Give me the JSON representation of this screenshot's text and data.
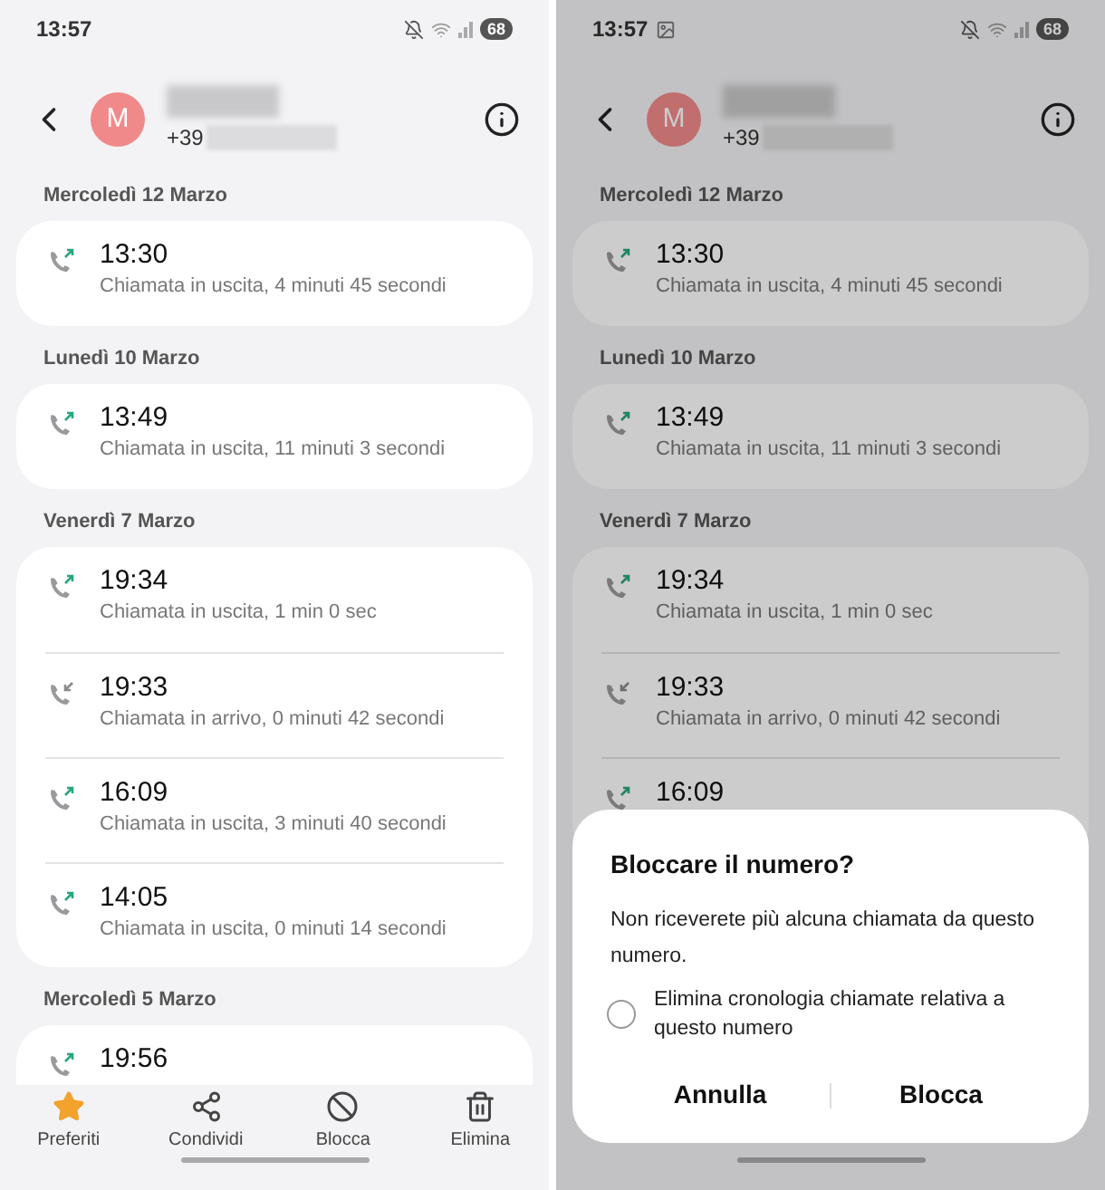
{
  "screens": [
    {
      "status_bar": {
        "time": "13:57",
        "photo_notification": false,
        "battery": "68"
      },
      "contact": {
        "initial": "M",
        "number_prefix": "+39"
      },
      "groups": [
        {
          "date": "Mercoledì 12 Marzo",
          "calls": [
            {
              "kind": "outgoing",
              "time": "13:30",
              "detail": "Chiamata in uscita, 4 minuti 45 secondi"
            }
          ]
        },
        {
          "date": "Lunedì 10 Marzo",
          "calls": [
            {
              "kind": "outgoing",
              "time": "13:49",
              "detail": "Chiamata in uscita, 11 minuti 3 secondi"
            }
          ]
        },
        {
          "date": "Venerdì 7 Marzo",
          "calls": [
            {
              "kind": "outgoing",
              "time": "19:34",
              "detail": "Chiamata in uscita, 1 min 0 sec"
            },
            {
              "kind": "incoming",
              "time": "19:33",
              "detail": "Chiamata in arrivo, 0 minuti 42 secondi"
            },
            {
              "kind": "outgoing",
              "time": "16:09",
              "detail": "Chiamata in uscita, 3 minuti 40 secondi"
            },
            {
              "kind": "outgoing",
              "time": "14:05",
              "detail": "Chiamata in uscita, 0 minuti 14 secondi"
            }
          ]
        },
        {
          "date": "Mercoledì 5 Marzo",
          "calls": [
            {
              "kind": "outgoing",
              "time": "19:56"
            }
          ]
        }
      ],
      "toolbar": [
        "Preferiti",
        "Condividi",
        "Blocca",
        "Elimina"
      ]
    },
    {
      "status_bar": {
        "time": "13:57",
        "photo_notification": true,
        "battery": "68"
      },
      "contact": {
        "initial": "M",
        "number_prefix": "+39"
      },
      "groups": [
        {
          "date": "Mercoledì 12 Marzo",
          "calls": [
            {
              "kind": "outgoing",
              "time": "13:30",
              "detail": "Chiamata in uscita, 4 minuti 45 secondi"
            }
          ]
        },
        {
          "date": "Lunedì 10 Marzo",
          "calls": [
            {
              "kind": "outgoing",
              "time": "13:49",
              "detail": "Chiamata in uscita, 11 minuti 3 secondi"
            }
          ]
        },
        {
          "date": "Venerdì 7 Marzo",
          "calls": [
            {
              "kind": "outgoing",
              "time": "19:34",
              "detail": "Chiamata in uscita, 1 min 0 sec"
            },
            {
              "kind": "incoming",
              "time": "19:33",
              "detail": "Chiamata in arrivo, 0 minuti 42 secondi"
            },
            {
              "kind": "outgoing",
              "time": "16:09"
            }
          ]
        }
      ],
      "dialog": {
        "title": "Bloccare il numero?",
        "message": "Non riceverete più alcuna chiamata da questo numero.",
        "option": {
          "label": "Elimina cronologia chiamate relativa a questo numero",
          "checked": false
        },
        "buttons": [
          "Annulla",
          "Blocca"
        ]
      }
    }
  ]
}
